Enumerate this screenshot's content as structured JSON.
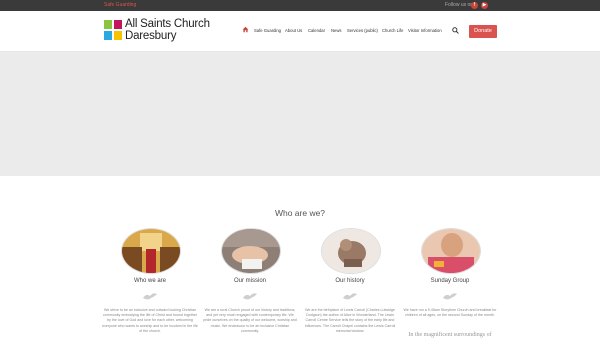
{
  "topbar": {
    "link": "Safe Guarding",
    "follow_label": "Follow us on",
    "social": [
      {
        "icon": "facebook-icon",
        "glyph": "f"
      },
      {
        "icon": "youtube-icon",
        "glyph": "▶"
      }
    ]
  },
  "header": {
    "logo": {
      "line1": "All Saints Church",
      "line2": "Daresbury"
    },
    "nav": [
      {
        "label": "Safe Guarding"
      },
      {
        "label": "About Us"
      },
      {
        "label": "Calendar"
      },
      {
        "label": "News"
      },
      {
        "label": "Services (public)"
      },
      {
        "label": "Church Life"
      },
      {
        "label": "Visitor Information"
      }
    ],
    "donate_label": "Donate"
  },
  "colors": {
    "accent": "#d9534f",
    "topbar": "#3a3a3a",
    "hero": "#ebebeb"
  },
  "section": {
    "title": "Who are we?",
    "columns": [
      {
        "title": "Who we are",
        "text": "We strive to be an inclusive and outward looking Christian community embodying the life of Christ and bound together by the love of God and love for each other, welcoming everyone who wants to worship and to be involved in the life of the church.",
        "more": ""
      },
      {
        "title": "Our mission",
        "text": "We are a rural Church proud of our history and traditions, and yet very much engaged with contemporary life. We pride ourselves on the quality of our welcome, worship and music. We endeavour to be an inclusive Christian community.",
        "more": ""
      },
      {
        "title": "Our history",
        "text": "We are the birthplace of Lewis Carroll (Charles Lutwidge Dodgson) the author of Alice in Wonderland. The Lewis Carroll Centre Service tells the story of the early life and influences. The Carroll Chapel contains the Lewis Carroll memorial window.",
        "more": ""
      },
      {
        "title": "Sunday Group",
        "text": "We have run a 9.45am Storytime Church and breakfast for children of all ages, on the second Sunday of the month.",
        "more": "In the magnificent surroundings of"
      }
    ]
  }
}
